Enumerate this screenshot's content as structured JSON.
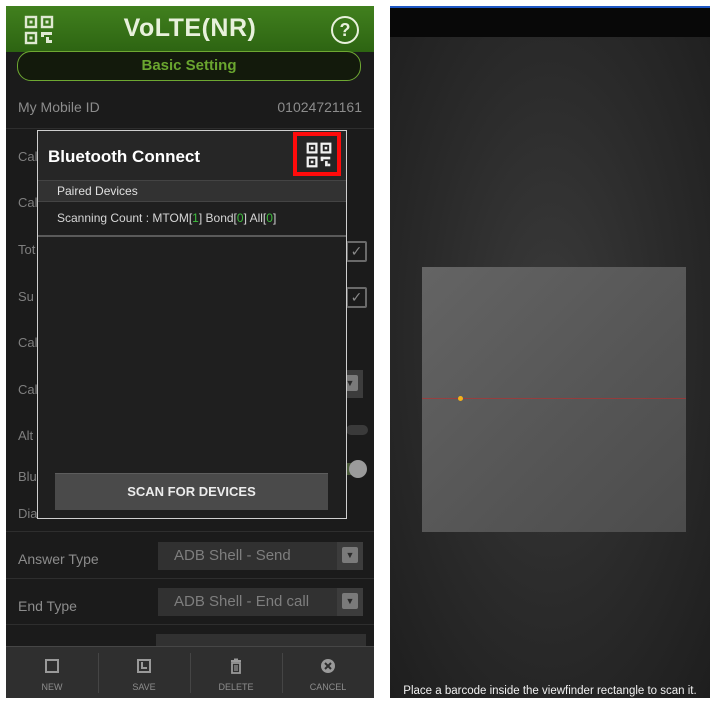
{
  "left_screen": {
    "app_title": "VoLTE(NR)",
    "help_label": "?",
    "basic_setting_label": "Basic Setting",
    "my_mobile_id_label": "My Mobile ID",
    "my_mobile_id_value": "01024721161",
    "partial_labels": [
      "Cal",
      "Cal",
      "Tot",
      "Su",
      "Cal",
      "Cal",
      "Alt",
      "Blu",
      "Dia"
    ],
    "answer_type_label": "Answer Type",
    "answer_type_value": "ADB Shell - Send",
    "end_type_label": "End Type",
    "end_type_value": "ADB Shell - End call",
    "dialog": {
      "title": "Bluetooth Connect",
      "paired_devices_label": "Paired Devices",
      "scan_count_prefix": "Scanning Count : MTOM[",
      "mtom_count": "1",
      "bond_prefix": "] Bond[",
      "bond_count": "0",
      "all_prefix": "] All[",
      "all_count": "0",
      "suffix": "]",
      "scan_button": "SCAN FOR DEVICES"
    },
    "toolbar": {
      "new_label": "NEW",
      "save_label": "SAVE",
      "delete_label": "DELETE",
      "cancel_label": "CANCEL"
    },
    "colors": {
      "header_green": "#3a7a1a",
      "count_green": "#3fbe3f",
      "highlight_red": "#ff0b0b"
    }
  },
  "right_screen": {
    "instructions": "Place a barcode inside the viewfinder rectangle to scan it."
  }
}
